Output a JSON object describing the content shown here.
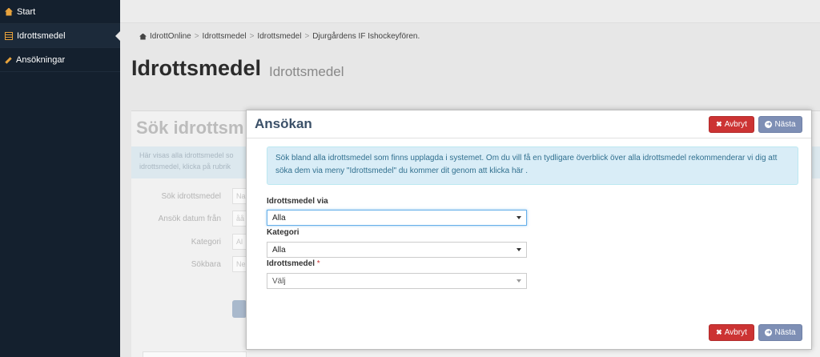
{
  "sidebar": {
    "items": [
      {
        "label": "Start",
        "icon": "home-icon"
      },
      {
        "label": "Idrottsmedel",
        "icon": "table-icon"
      },
      {
        "label": "Ansökningar",
        "icon": "pencil-icon"
      }
    ],
    "active_index": 1
  },
  "breadcrumb": [
    "IdrottOnline",
    "Idrottsmedel",
    "Idrottsmedel",
    "Djurgårdens IF Ishockeyfören."
  ],
  "page": {
    "title": "Idrottsmedel",
    "subtitle": "Idrottsmedel"
  },
  "background_panel": {
    "title": "Sök idrottsm",
    "info_line1": "Här visas alla idrottsmedel so",
    "info_line2": "idrottsmedel, klicka på rubrik",
    "labels": [
      "Sök idrottsmedel",
      "Ansök datum från",
      "Kategori",
      "Sökbara"
    ],
    "values": [
      "Na",
      "åå",
      "Al",
      "Ne"
    ]
  },
  "modal": {
    "title": "Ansökan",
    "cancel_label": "Avbryt",
    "next_label": "Nästa",
    "info_text": "Sök bland alla idrottsmedel som finns upplagda i systemet. Om du vill få en tydligare överblick över alla idrottsmedel rekommenderar vi dig att söka dem via meny \"Idrottsmedel\" du kommer dit genom att klicka här .",
    "fields": [
      {
        "label": "Idrottsmedel via",
        "value": "Alla",
        "required": false
      },
      {
        "label": "Kategori",
        "value": "Alla",
        "required": false
      },
      {
        "label": "Idrottsmedel",
        "value": "Välj",
        "required": true
      }
    ],
    "required_marker": "*"
  },
  "colors": {
    "sidebar_bg": "#14202e",
    "accent_icon": "#e8a33d",
    "danger": "#cc3333",
    "primary": "#7e8fb5",
    "info_bg": "#d9edf7",
    "info_text": "#31708f"
  }
}
